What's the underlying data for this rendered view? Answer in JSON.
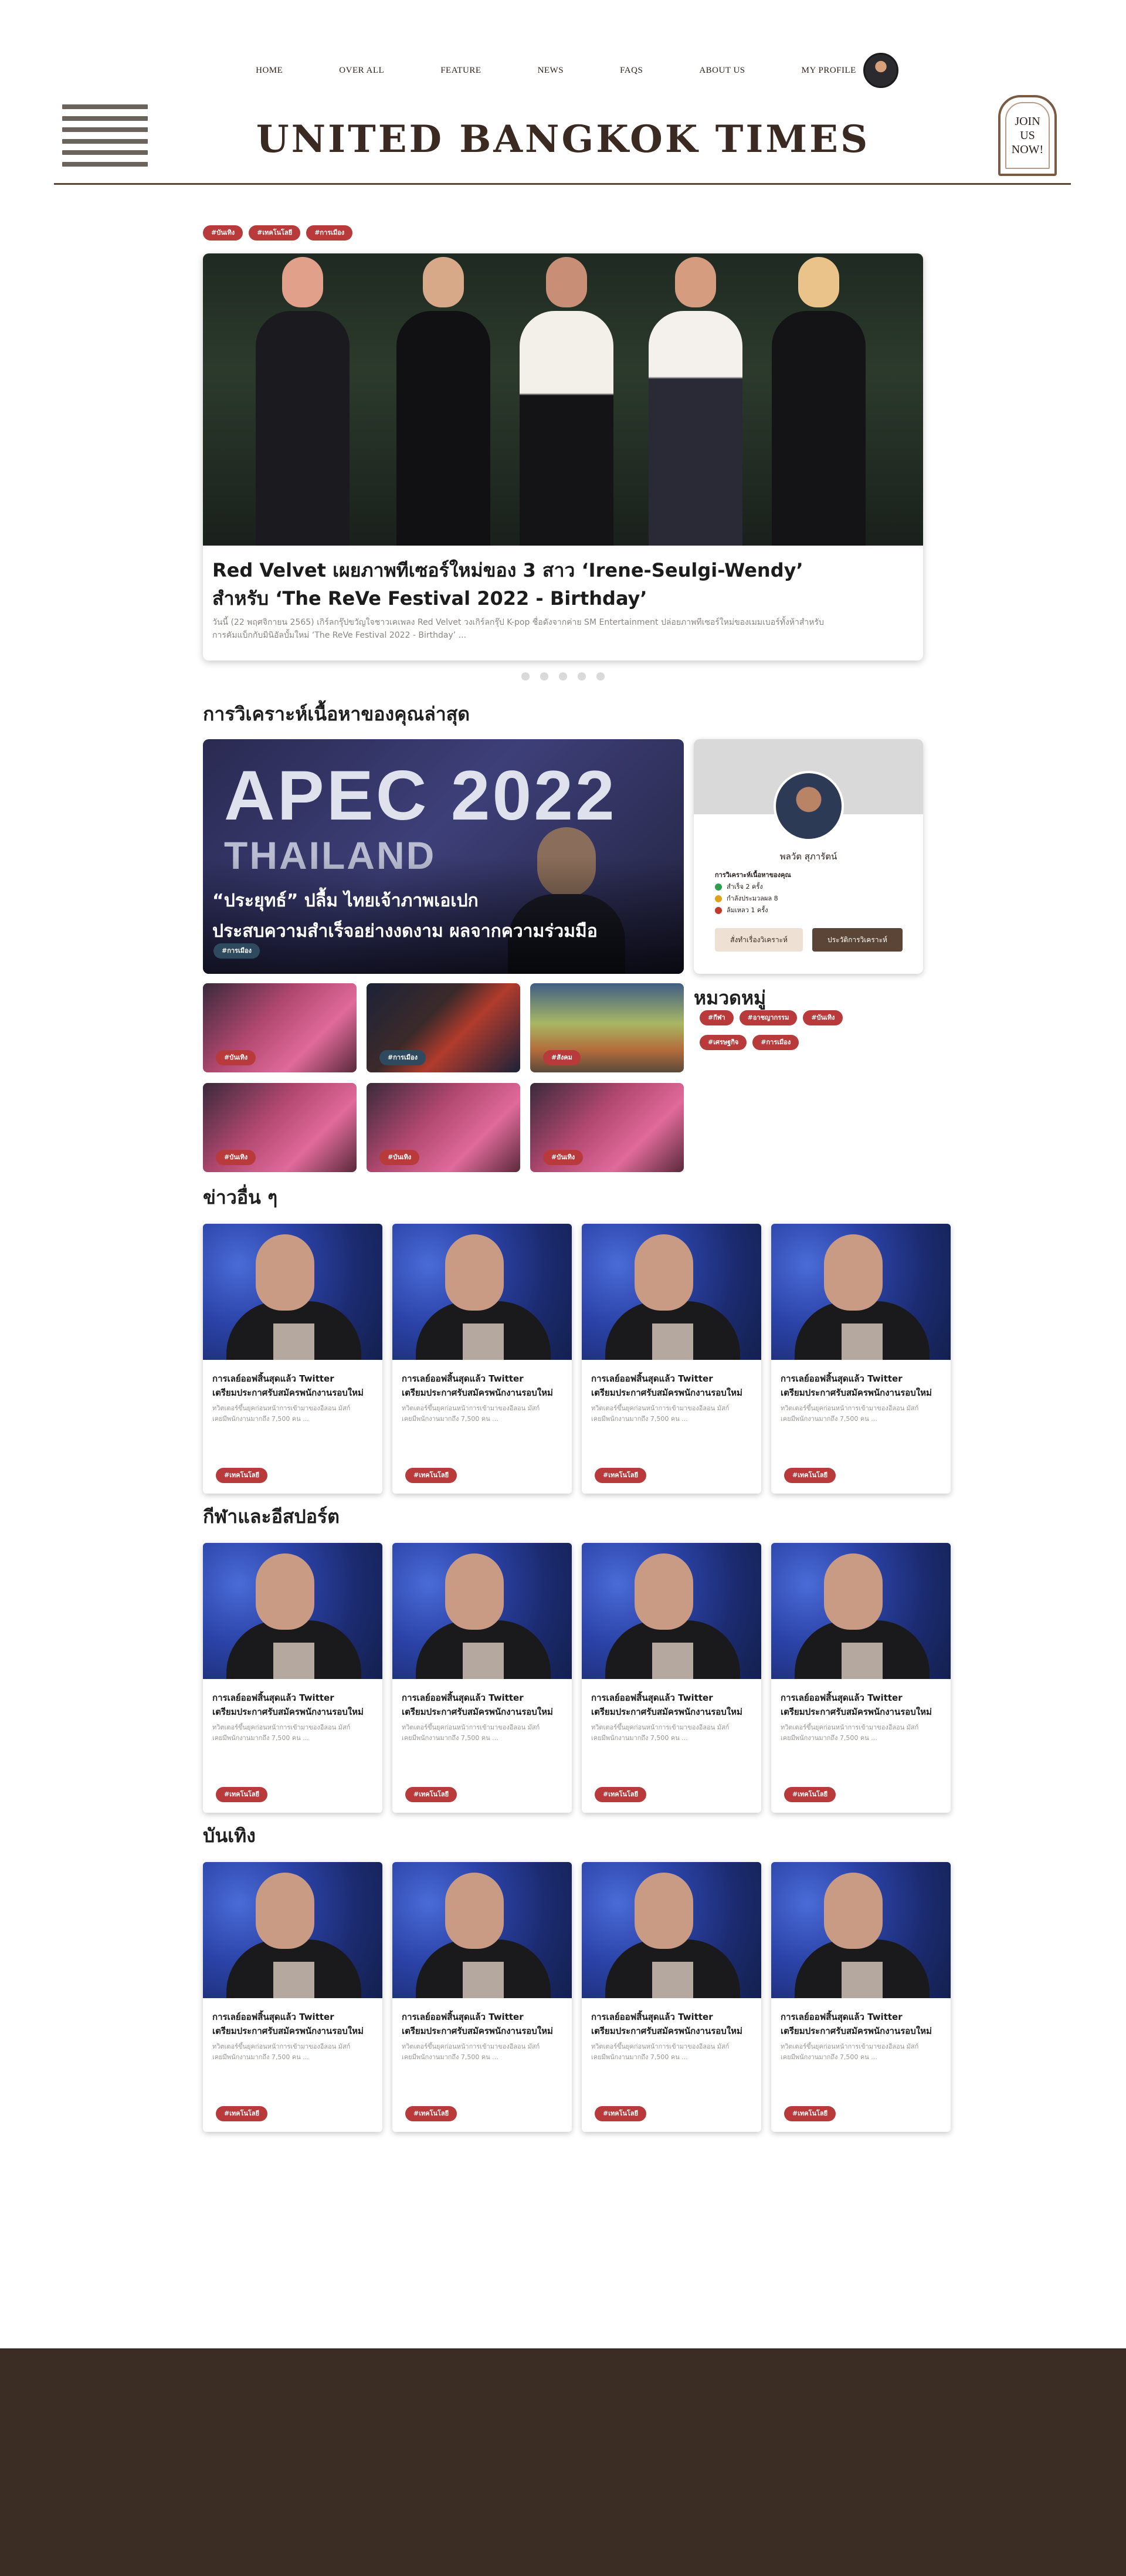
{
  "nav": {
    "items": [
      "HOME",
      "OVER ALL",
      "FEATURE",
      "NEWS",
      "FAQs",
      "ABOUT US",
      "MY PROFILE"
    ]
  },
  "masthead": {
    "title": "UNITED BANGKOK TIMES"
  },
  "join": {
    "label": "JOIN US NOW!"
  },
  "hero": {
    "tags": [
      "#บันเทิง",
      "#เทคโนโลยี",
      "#การเมือง"
    ],
    "title_line1": "Red Velvet เผยภาพทีเซอร์ใหม่ของ 3 สาว ‘Irene-Seulgi-Wendy’",
    "title_line2": "สำหรับ ‘The ReVe Festival 2022 - Birthday’",
    "excerpt": "วันนี้ (22 พฤศจิกายน 2565) เกิร์ลกรุ๊ปขวัญใจชาวเคเพลง Red Velvet วงเกิร์ลกรุ๊ป K-pop ชื่อดังจากค่าย SM Entertainment ปล่อยภาพทีเซอร์ใหม่ของเมมเบอร์ทั้งห้าสำหรับการคัมแบ็กกับมินิอัลบั้มใหม่ ‘The ReVe Festival 2022 - Birthday’ ..."
  },
  "analysis": {
    "heading": "การวิเคราะห์เนื้อหาของคุณล่าสุด",
    "feature": {
      "apec_line1": "APEC 2022",
      "apec_line2": "THAILAND",
      "title_line1": "“ประยุทธ์” ปลื้ม ไทยเจ้าภาพเอเปก",
      "title_line2": "ประสบความสำเร็จอย่างงดงาม ผลจากความร่วมมือ",
      "tag": "#การเมือง"
    },
    "thumbs": [
      {
        "tag": "#บันเทิง"
      },
      {
        "tag": "#การเมือง"
      },
      {
        "tag": "#สังคม"
      },
      {
        "tag": "#บันเทิง"
      },
      {
        "tag": "#บันเทิง"
      },
      {
        "tag": "#บันเทิง"
      }
    ]
  },
  "profile": {
    "name": "พลวัต สุภารัตน์",
    "stats_title": "การวิเคราะห์เนื้อหาของคุณ",
    "stats": [
      {
        "label": "สำเร็จ 2 ครั้ง",
        "color": "#2e9e4f"
      },
      {
        "label": "กำลังประมวลผล 8",
        "color": "#e0a21a"
      },
      {
        "label": "ล้มเหลว 1 ครั้ง",
        "color": "#c0392b"
      }
    ],
    "btn_history": "สั่งทำเรื่องวิเคราะห์",
    "btn_new": "ประวัติการวิเคราะห์"
  },
  "categories": {
    "heading": "หมวดหมู่",
    "row1": [
      "#กีฬา",
      "#อาชญากรรม",
      "#บันเทิง"
    ],
    "row2": [
      "#เศรษฐกิจ",
      "#การเมือง"
    ]
  },
  "sections": [
    {
      "heading": "ข่าวอื่น ๆ"
    },
    {
      "heading": "กีฬาและอีสปอร์ต"
    },
    {
      "heading": "บันเทิง"
    }
  ],
  "card": {
    "title_line1": "การเลย์ออฟสิ้นสุดแล้ว Twitter",
    "title_line2": "เตรียมประกาศรับสมัครพนักงานรอบใหม่",
    "excerpt_line1": "ทวิตเตอร์ขึ้นยุคก่อนหน้าการเข้ามาของอีลอน มัสก์",
    "excerpt_line2": "เคยมีพนักงานมากถึง 7,500 คน ...",
    "tag": "#เทคโนโลยี"
  }
}
